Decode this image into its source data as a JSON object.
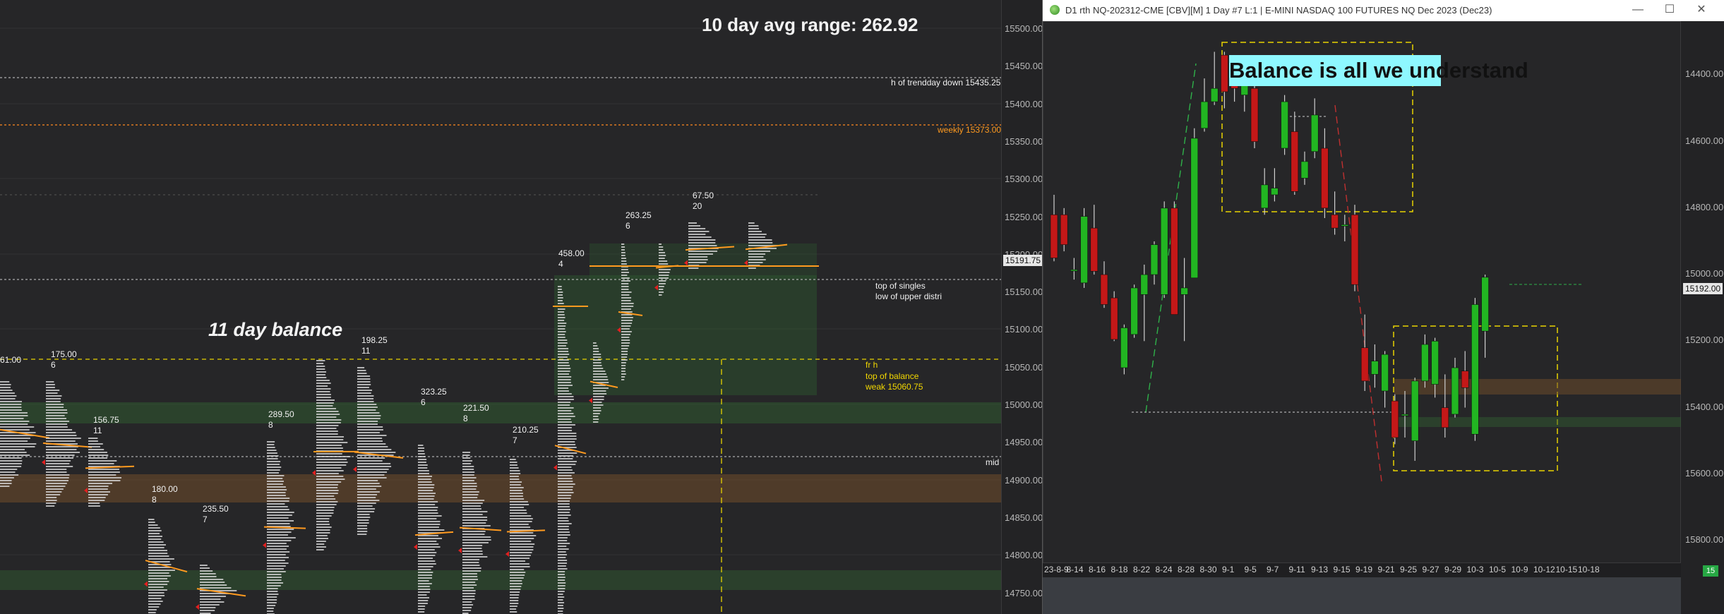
{
  "left_panel": {
    "headline": "10 day avg range:  262.92",
    "balance_label": "11 day balance",
    "annotations": {
      "trendday": "h of trendday down  15435.25",
      "weekly": "weekly  15373.00",
      "singles_1": "top of singles",
      "singles_2": "low of upper distri",
      "balance_1": "fr h",
      "balance_2": "top of balance",
      "balance_3": "weak  15060.75",
      "mid": "mid"
    },
    "profile_labels": [
      {
        "v": "61.00",
        "n": ""
      },
      {
        "v": "175.00",
        "n": "6"
      },
      {
        "v": "156.75",
        "n": "11"
      },
      {
        "v": "180.00",
        "n": "8"
      },
      {
        "v": "235.50",
        "n": "7"
      },
      {
        "v": "289.50",
        "n": "8"
      },
      {
        "v": "198.25",
        "n": "11"
      },
      {
        "v": "323.25",
        "n": "6"
      },
      {
        "v": "221.50",
        "n": "8"
      },
      {
        "v": "210.25",
        "n": "7"
      },
      {
        "v": "458.00",
        "n": "4"
      },
      {
        "v": "263.25",
        "n": "6"
      },
      {
        "v": "67.50",
        "n": "20"
      }
    ],
    "axis_ticks": [
      "15500.00",
      "15450.00",
      "15400.00",
      "15350.00",
      "15300.00",
      "15250.00",
      "15200.00",
      "15150.00",
      "15100.00",
      "15050.00",
      "15000.00",
      "14950.00",
      "14900.00",
      "14850.00",
      "14800.00",
      "14750.00"
    ],
    "current_price": "15191.75",
    "trendday_tag": "15435.25",
    "weekly_tag": "15373.00",
    "colors": {
      "accent_orange": "#ff9a1f",
      "balance_yellow": "#e8d400",
      "profile_white": "#e6e6e6",
      "green_zone": "#2f6b2f",
      "orange_zone": "#6b4a2a"
    }
  },
  "right_window": {
    "title": "D1 rth NQ-202312-CME [CBV][M]  1 Day  #7 L:1 | E-MINI NASDAQ 100 FUTURES NQ Dec 2023 (Dec23)",
    "controls": {
      "minimize": "—",
      "maximize": "☐",
      "close": "✕"
    },
    "callout": "Balance is all we understand",
    "corner_badge": "15",
    "current_price": "15192.00",
    "axis_ticks": [
      "15800.00",
      "15600.00",
      "15400.00",
      "15200.00",
      "15000.00",
      "14800.00",
      "14600.00",
      "14400.00"
    ]
  },
  "chart_data": {
    "type": "candlestick",
    "title": "Balance is all we understand",
    "ylim": [
      14330,
      15960
    ],
    "yticks": [
      14400,
      14600,
      14800,
      15000,
      15200,
      15400,
      15600,
      15800
    ],
    "x_tick_labels": [
      "23-8-9",
      "8-14",
      "8-16",
      "8-18",
      "8-22",
      "8-24",
      "8-28",
      "8-30",
      "9-1",
      "9-5",
      "9-7",
      "9-11",
      "9-13",
      "9-15",
      "9-19",
      "9-21",
      "9-25",
      "9-27",
      "9-29",
      "10-3",
      "10-5",
      "10-9",
      "10-12",
      "10-15",
      "10-18"
    ],
    "candles": [
      {
        "o": 15380,
        "h": 15440,
        "l": 15240,
        "c": 15250
      },
      {
        "o": 15380,
        "h": 15400,
        "l": 15270,
        "c": 15290
      },
      {
        "o": 15215,
        "h": 15250,
        "l": 15185,
        "c": 15215
      },
      {
        "o": 15175,
        "h": 15400,
        "l": 15160,
        "c": 15375
      },
      {
        "o": 15340,
        "h": 15410,
        "l": 15200,
        "c": 15210
      },
      {
        "o": 15200,
        "h": 15240,
        "l": 15100,
        "c": 15110
      },
      {
        "o": 15130,
        "h": 15150,
        "l": 15000,
        "c": 15005
      },
      {
        "o": 14920,
        "h": 15050,
        "l": 14900,
        "c": 15040
      },
      {
        "o": 15020,
        "h": 15170,
        "l": 15010,
        "c": 15160
      },
      {
        "o": 15140,
        "h": 15230,
        "l": 15000,
        "c": 15200
      },
      {
        "o": 15200,
        "h": 15300,
        "l": 15170,
        "c": 15290
      },
      {
        "o": 15140,
        "h": 15420,
        "l": 15130,
        "c": 15400
      },
      {
        "o": 15400,
        "h": 15420,
        "l": 15080,
        "c": 15080
      },
      {
        "o": 15140,
        "h": 15250,
        "l": 15000,
        "c": 15160
      },
      {
        "o": 15190,
        "h": 15640,
        "l": 15190,
        "c": 15610
      },
      {
        "o": 15640,
        "h": 15790,
        "l": 15630,
        "c": 15720
      },
      {
        "o": 15720,
        "h": 15870,
        "l": 15710,
        "c": 15760
      },
      {
        "o": 15860,
        "h": 15870,
        "l": 15700,
        "c": 15750
      },
      {
        "o": 15800,
        "h": 15850,
        "l": 15720,
        "c": 15760
      },
      {
        "o": 15740,
        "h": 15800,
        "l": 15690,
        "c": 15780
      },
      {
        "o": 15760,
        "h": 15770,
        "l": 15580,
        "c": 15600
      },
      {
        "o": 15400,
        "h": 15520,
        "l": 15380,
        "c": 15470
      },
      {
        "o": 15440,
        "h": 15520,
        "l": 15420,
        "c": 15460
      },
      {
        "o": 15580,
        "h": 15740,
        "l": 15560,
        "c": 15720
      },
      {
        "o": 15630,
        "h": 15690,
        "l": 15440,
        "c": 15450
      },
      {
        "o": 15490,
        "h": 15570,
        "l": 15470,
        "c": 15540
      },
      {
        "o": 15570,
        "h": 15730,
        "l": 15550,
        "c": 15680
      },
      {
        "o": 15580,
        "h": 15640,
        "l": 15370,
        "c": 15400
      },
      {
        "o": 15380,
        "h": 15450,
        "l": 15320,
        "c": 15340
      },
      {
        "o": 15350,
        "h": 15380,
        "l": 15300,
        "c": 15350
      },
      {
        "o": 15380,
        "h": 15410,
        "l": 15150,
        "c": 15170
      },
      {
        "o": 14980,
        "h": 15080,
        "l": 14850,
        "c": 14880
      },
      {
        "o": 14900,
        "h": 14990,
        "l": 14860,
        "c": 14940
      },
      {
        "o": 14850,
        "h": 14970,
        "l": 14800,
        "c": 14960
      },
      {
        "o": 14820,
        "h": 14840,
        "l": 14690,
        "c": 14710
      },
      {
        "o": 14780,
        "h": 14850,
        "l": 14710,
        "c": 14780
      },
      {
        "o": 14700,
        "h": 14890,
        "l": 14640,
        "c": 14880
      },
      {
        "o": 14880,
        "h": 15020,
        "l": 14860,
        "c": 14990
      },
      {
        "o": 14870,
        "h": 15010,
        "l": 14830,
        "c": 15000
      },
      {
        "o": 14800,
        "h": 14900,
        "l": 14710,
        "c": 14740
      },
      {
        "o": 14780,
        "h": 14950,
        "l": 14770,
        "c": 14920
      },
      {
        "o": 14910,
        "h": 14970,
        "l": 14800,
        "c": 14860
      },
      {
        "o": 14720,
        "h": 15130,
        "l": 14700,
        "c": 15110
      },
      {
        "o": 15030,
        "h": 15200,
        "l": 14950,
        "c": 15192
      }
    ],
    "x_start": 1483,
    "x_step": 14.2
  }
}
